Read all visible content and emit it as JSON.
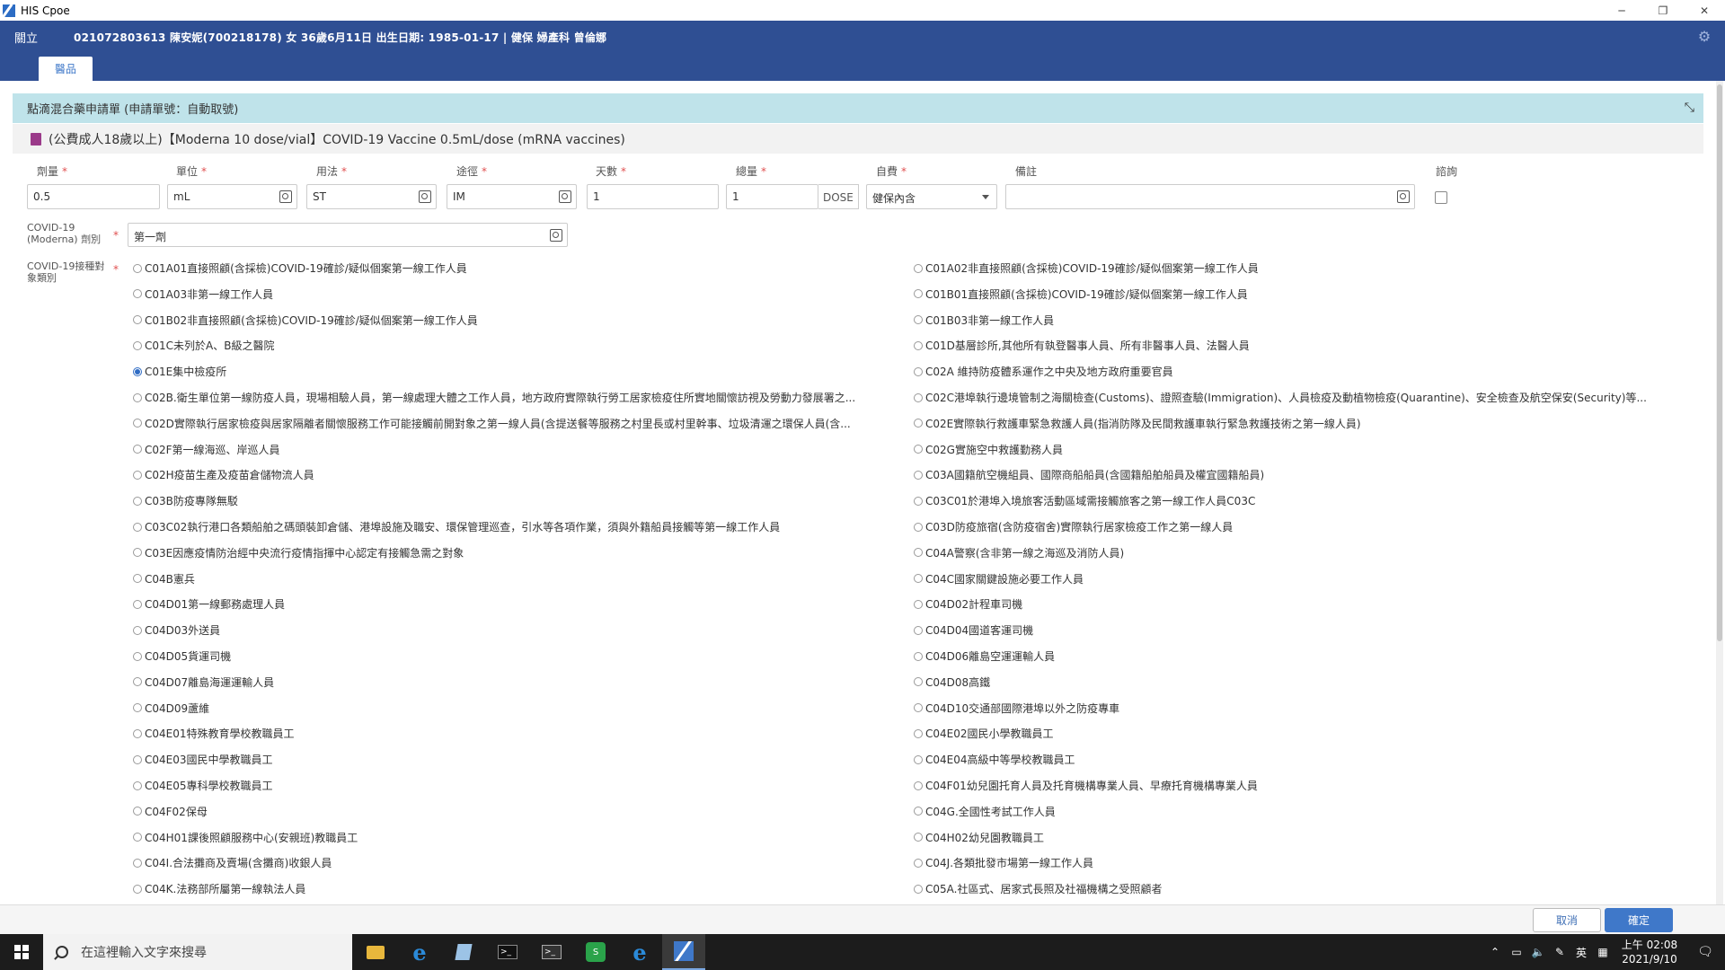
{
  "window": {
    "title": "HIS Cpoe",
    "minimize": "─",
    "restore": "❐",
    "close": "✕"
  },
  "patient": {
    "close_label": "關立",
    "info": "021072803613  陳安妮(700218178)  女  36歲6月11日  出生日期: 1985-01-17  |  健保  婦產科  曾倫娜"
  },
  "tabs": [
    {
      "label": "醫品"
    }
  ],
  "panel": {
    "title": "點滴混合藥申請單 (申請單號：自動取號)",
    "drug": "(公費成人18歲以上)【Moderna 10 dose/vial】COVID-19 Vaccine 0.5mL/dose (mRNA vaccines)"
  },
  "form": {
    "labels": {
      "dose": "劑量",
      "unit": "單位",
      "usage": "用法",
      "route": "途徑",
      "days": "天數",
      "total": "總量",
      "payer": "自費",
      "remark": "備註",
      "consult": "諮詢"
    },
    "values": {
      "dose": "0.5",
      "unit": "mL",
      "usage": "ST",
      "route": "IM",
      "days": "1",
      "total": "1",
      "total_unit": "DOSE",
      "payer": "健保內含",
      "remark": ""
    },
    "dose_number_label": "COVID-19 (Moderna) 劑別",
    "dose_number_value": "第一劑",
    "category_label": "COVID-19接種對象類別",
    "required_mark": "*"
  },
  "categories_left": [
    "C01A01直接照顧(含採檢)COVID-19確診/疑似個案第一線工作人員",
    "C01A03非第一線工作人員",
    "C01B02非直接照顧(含採檢)COVID-19確診/疑似個案第一線工作人員",
    "C01C未列於A、B級之醫院",
    "C01E集中檢疫所",
    "C02B.衛生單位第一線防疫人員，現場相驗人員，第一線處理大體之工作人員，地方政府實際執行勞工居家檢疫住所實地關懷訪視及勞動力發展署之...",
    "C02D實際執行居家檢疫與居家隔離者關懷服務工作可能接觸前開對象之第一線人員(含提送餐等服務之村里長或村里幹事、垃圾清運之環保人員(含...",
    "C02F第一線海巡、岸巡人員",
    "C02H疫苗生產及疫苗倉儲物流人員",
    "C03B防疫專隊無駁",
    "C03C02執行港口各類船舶之碼頭裝卸倉儲、港埠設施及職安、環保管理巡查，引水等各項作業，須與外籍船員接觸等第一線工作人員",
    "C03E因應疫情防治經中央流行疫情指揮中心認定有接觸急需之對象",
    "C04B憲兵",
    "C04D01第一線郵務處理人員",
    "C04D03外送員",
    "C04D05貨運司機",
    "C04D07離島海運運輸人員",
    "C04D09蘆維",
    "C04E01特殊教育學校教職員工",
    "C04E03國民中學教職員工",
    "C04E05專科學校教職員工",
    "C04F02保母",
    "C04H01課後照顧服務中心(安親班)教職員工",
    "C04I.合法攤商及賣場(含攤商)收銀人員",
    "C04K.法務部所屬第一線執法人員"
  ],
  "categories_right": [
    "C01A02非直接照顧(含採檢)COVID-19確診/疑似個案第一線工作人員",
    "C01B01直接照顧(含採檢)COVID-19確診/疑似個案第一線工作人員",
    "C01B03非第一線工作人員",
    "C01D基層診所,其他所有執登醫事人員、所有非醫事人員、法醫人員",
    "C02A 維持防疫體系運作之中央及地方政府重要官員",
    "C02C港埠執行邊境管制之海關檢查(Customs)、證照查驗(Immigration)、人員檢疫及動植物檢疫(Quarantine)、安全檢查及航空保安(Security)等...",
    "C02E實際執行救護車緊急救護人員(指消防隊及民間救護車執行緊急救護技術之第一線人員)",
    "C02G實施空中救護勤務人員",
    "C03A國籍航空機組員、國際商船船員(含國籍船舶船員及權宜國籍船員)",
    "C03C01於港埠入境旅客活動區域需接觸旅客之第一線工作人員C03C",
    "C03D防疫旅宿(含防疫宿舍)實際執行居家檢疫工作之第一線人員",
    "C04A警察(含非第一線之海巡及消防人員)",
    "C04C國家關鍵設施必要工作人員",
    "C04D02計程車司機",
    "C04D04國道客運司機",
    "C04D06離島空運運輸人員",
    "C04D08高鐵",
    "C04D10交通部國際港埠以外之防疫專車",
    "C04E02國民小學教職員工",
    "C04E04高級中等學校教職員工",
    "C04F01幼兒園托育人員及托育機構專業人員、早療托育機構專業人員",
    "C04G.全國性考試工作人員",
    "C04H02幼兒園教職員工",
    "C04J.各類批發市場第一線工作人員",
    "C05A.社區式、居家式長照及社福機構之受照顧者"
  ],
  "selected_category": "C01E集中檢疫所",
  "buttons": {
    "cancel": "取消",
    "confirm": "確定"
  },
  "taskbar": {
    "search_placeholder": "在這裡輸入文字來搜尋",
    "ime": "英",
    "time": "上午 02:08",
    "date": "2021/9/10",
    "notifications": "1"
  }
}
